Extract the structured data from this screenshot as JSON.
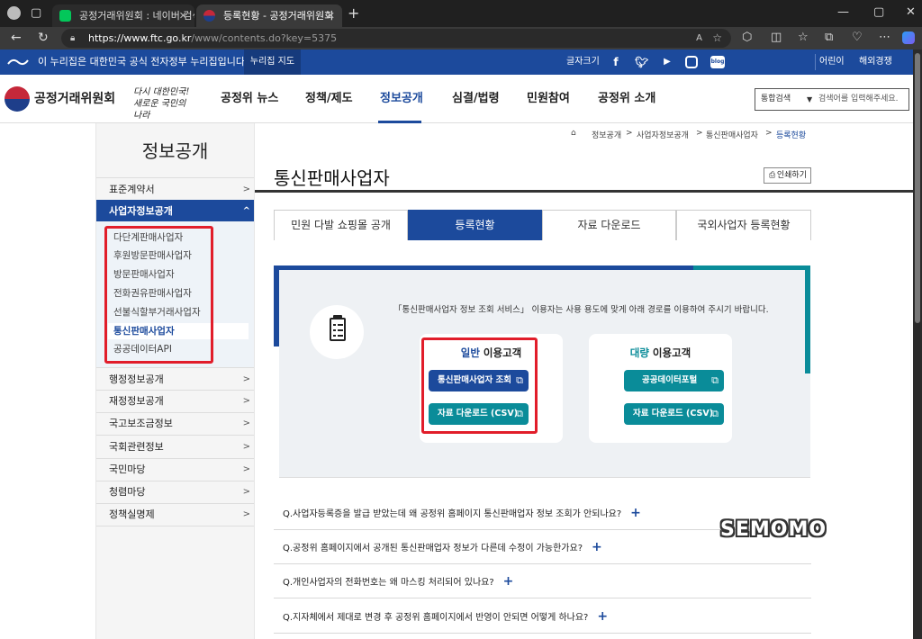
{
  "browser": {
    "tabs": [
      {
        "title": "공정거래위원회 : 네이버 검색",
        "favicon": "naver-icon",
        "favicon_color": "#03c75a"
      },
      {
        "title": "등록현황 - 공정거래위원회",
        "favicon": "ftc-icon",
        "favicon_color": "#c5283a"
      }
    ],
    "url_host": "https://www.ftc.go.kr",
    "url_path": "/www/contents.do?key=5375",
    "new_tab": "+"
  },
  "gov_bar": {
    "text": "이 누리집은 대한민국 공식 전자정부 누리집입니다",
    "sitemap": "누리집 지도",
    "font_size": "글자크기",
    "sns_blog": "blog",
    "kids": "어린이",
    "english": "해외경쟁"
  },
  "header": {
    "logo": "공정거래위원회",
    "slogan_line1": "다시 대한민국!",
    "slogan_line2": "새로운 국민의 나라",
    "nav": [
      "공정위 뉴스",
      "정책/제도",
      "정보공개",
      "심결/법령",
      "민원참여",
      "공정위 소개"
    ],
    "active_nav": "정보공개",
    "search_select": "통합검색",
    "search_placeholder": "검색어를 입력해주세요."
  },
  "sidebar": {
    "title": "정보공개",
    "items": [
      {
        "label": "표준계약서"
      },
      {
        "label": "사업자정보공개",
        "open": true
      },
      {
        "label": "행정정보공개"
      },
      {
        "label": "재정정보공개"
      },
      {
        "label": "국고보조금정보"
      },
      {
        "label": "국회관련정보"
      },
      {
        "label": "국민마당"
      },
      {
        "label": "청렴마당"
      },
      {
        "label": "정책실명제"
      }
    ],
    "sub_items": [
      "다단계판매사업자",
      "후원방문판매사업자",
      "방문판매사업자",
      "전화권유판매사업자",
      "선불식할부거래사업자",
      "통신판매사업자",
      "공공데이터API"
    ],
    "active_sub": "통신판매사업자"
  },
  "breadcrumb": [
    "정보공개",
    "사업자정보공개",
    "통신판매사업자",
    "등록현황"
  ],
  "content": {
    "title": "통신판매사업자",
    "print": "인쇄하기",
    "tabs": [
      "민원 다발 쇼핑몰 공개",
      "등록현황",
      "자료 다운로드",
      "국외사업자 등록현황"
    ],
    "active_tab": "등록현황",
    "notice": "「통신판매사업자 정보 조회 서비스」 이용자는 사용 용도에 맞게 아래 경로를 이용하여 주시기 바랍니다.",
    "general": {
      "title_hl": "일반",
      "title_rest": " 이용고객",
      "btn1": "통신판매사업자 조회",
      "btn2": "자료 다운로드 (CSV)"
    },
    "bulk": {
      "title_hl": "대량",
      "title_rest": " 이용고객",
      "btn1": "공공데이터포털",
      "btn2": "자료 다운로드 (CSV)"
    },
    "faqs": [
      "Q.사업자등록증을 발급 받았는데 왜 공정위 홈페이지 통신판매업자 정보 조회가 안되나요?",
      "Q.공정위 홈페이지에서 공개된 통신판매업자 정보가 다른데 수정이 가능한가요?",
      "Q.개인사업자의 전화번호는 왜 마스킹 처리되어 있나요?",
      "Q.지자체에서 제대로 변경 후 공정위 홈페이지에서 반영이 안되면 어떻게 하나요?"
    ],
    "plus": "+"
  },
  "watermark": "SEMOMO",
  "colors": {
    "brand_blue": "#1c4a9c",
    "brand_teal": "#0a8c99",
    "highlight_red": "#e11d2a"
  }
}
